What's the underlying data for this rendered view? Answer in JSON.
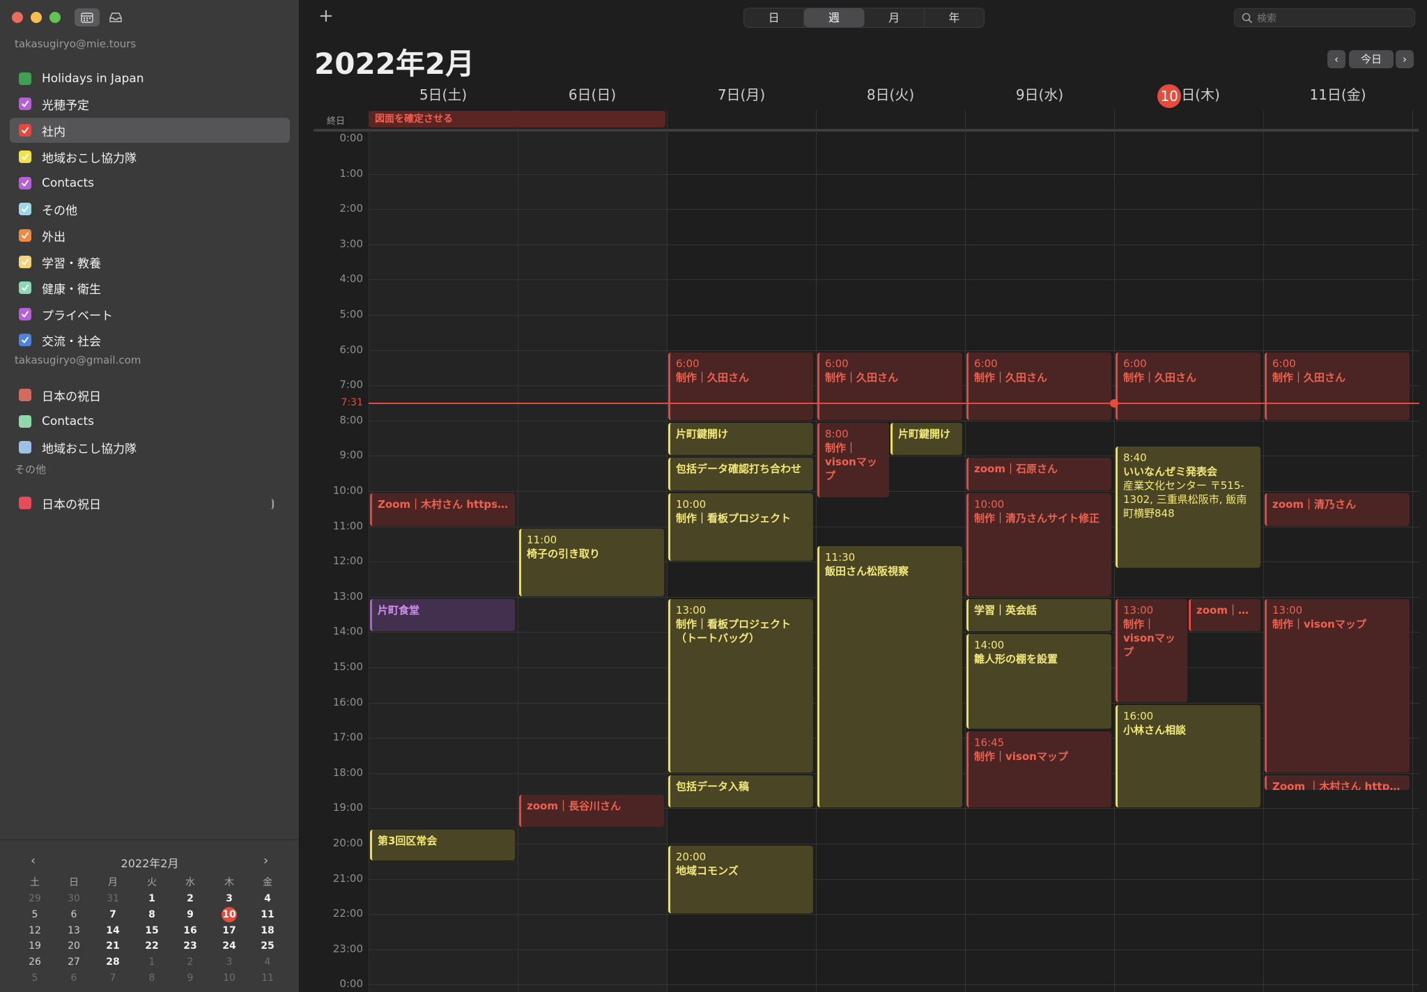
{
  "sidebar": {
    "accounts": [
      {
        "email": "takasugiryo@mie.tours",
        "calendars": [
          {
            "name": "Holidays in Japan",
            "color": "#3fa14f",
            "checked": false
          },
          {
            "name": "光穂予定",
            "color": "#b65fd6",
            "checked": true
          },
          {
            "name": "社内",
            "color": "#e8473c",
            "checked": true,
            "selected": true
          },
          {
            "name": "地域おこし協力隊",
            "color": "#f2e24a",
            "checked": true
          },
          {
            "name": "Contacts",
            "color": "#b65fd6",
            "checked": true
          },
          {
            "name": "その他",
            "color": "#9fd7e8",
            "checked": true
          },
          {
            "name": "外出",
            "color": "#f08a3e",
            "checked": true
          },
          {
            "name": "学習・教養",
            "color": "#f3d27a",
            "checked": true
          },
          {
            "name": "健康・衛生",
            "color": "#8bd8b2",
            "checked": true
          },
          {
            "name": "プライベート",
            "color": "#b65fd6",
            "checked": true
          },
          {
            "name": "交流・社会",
            "color": "#4c82e0",
            "checked": true
          }
        ]
      },
      {
        "email": "takasugiryo@gmail.com",
        "calendars": [
          {
            "name": "日本の祝日",
            "color": "#d46a5e",
            "checked": false
          },
          {
            "name": "Contacts",
            "color": "#8fd9a8",
            "checked": false
          },
          {
            "name": "地域おこし協力隊",
            "color": "#9fc0e6",
            "checked": false
          }
        ]
      },
      {
        "email": "その他",
        "calendars": [
          {
            "name": "日本の祝日",
            "color": "#e84b5a",
            "checked": false,
            "broadcast": true
          }
        ]
      }
    ]
  },
  "mini_calendar": {
    "title": "2022年2月",
    "prev": "‹",
    "next": "›",
    "weekdays": [
      "土",
      "日",
      "月",
      "火",
      "水",
      "木",
      "金"
    ],
    "weeks": [
      [
        {
          "d": "29",
          "dim": true
        },
        {
          "d": "30",
          "dim": true
        },
        {
          "d": "31",
          "dim": true
        },
        {
          "d": "1",
          "b": true
        },
        {
          "d": "2",
          "b": true
        },
        {
          "d": "3",
          "b": true
        },
        {
          "d": "4",
          "b": true
        }
      ],
      [
        {
          "d": "5"
        },
        {
          "d": "6"
        },
        {
          "d": "7",
          "b": true
        },
        {
          "d": "8",
          "b": true
        },
        {
          "d": "9",
          "b": true
        },
        {
          "d": "10",
          "today": true
        },
        {
          "d": "11",
          "b": true
        }
      ],
      [
        {
          "d": "12"
        },
        {
          "d": "13"
        },
        {
          "d": "14",
          "b": true
        },
        {
          "d": "15",
          "b": true
        },
        {
          "d": "16",
          "b": true
        },
        {
          "d": "17",
          "b": true
        },
        {
          "d": "18",
          "b": true
        }
      ],
      [
        {
          "d": "19"
        },
        {
          "d": "20"
        },
        {
          "d": "21",
          "b": true
        },
        {
          "d": "22",
          "b": true
        },
        {
          "d": "23",
          "b": true
        },
        {
          "d": "24",
          "b": true
        },
        {
          "d": "25",
          "b": true
        }
      ],
      [
        {
          "d": "26"
        },
        {
          "d": "27"
        },
        {
          "d": "28",
          "b": true
        },
        {
          "d": "1",
          "dim": true
        },
        {
          "d": "2",
          "dim": true
        },
        {
          "d": "3",
          "dim": true
        },
        {
          "d": "4",
          "dim": true
        }
      ],
      [
        {
          "d": "5",
          "dim": true
        },
        {
          "d": "6",
          "dim": true
        },
        {
          "d": "7",
          "dim": true
        },
        {
          "d": "8",
          "dim": true
        },
        {
          "d": "9",
          "dim": true
        },
        {
          "d": "10",
          "dim": true
        },
        {
          "d": "11",
          "dim": true
        }
      ]
    ]
  },
  "toolbar": {
    "add": "+",
    "views": [
      "日",
      "週",
      "月",
      "年"
    ],
    "active_view": "週",
    "search_placeholder": "検索"
  },
  "header": {
    "title": "2022年2月",
    "prev": "‹",
    "today": "今日",
    "next": "›"
  },
  "days": [
    {
      "label": "5日(土)",
      "weekend": true
    },
    {
      "label": "6日(日)",
      "weekend": true
    },
    {
      "label": "7日(月)"
    },
    {
      "label": "8日(火)"
    },
    {
      "label": "9日(水)"
    },
    {
      "num": "10",
      "rest": "日(木)",
      "today": true
    },
    {
      "label": "11日(金)"
    }
  ],
  "allday_label": "終日",
  "allday_events": [
    {
      "title": "図面を確定させる",
      "day": 0,
      "span": 2,
      "color": "red"
    }
  ],
  "hours": [
    "0:00",
    "1:00",
    "2:00",
    "3:00",
    "4:00",
    "5:00",
    "6:00",
    "7:00",
    "8:00",
    "9:00",
    "10:00",
    "11:00",
    "12:00",
    "13:00",
    "14:00",
    "15:00",
    "16:00",
    "17:00",
    "18:00",
    "19:00",
    "20:00",
    "21:00",
    "22:00",
    "23:00",
    "0:00"
  ],
  "now": {
    "label": "7:31",
    "hour": 7.5167,
    "day": 5
  },
  "events": [
    {
      "day": 0,
      "start": 10,
      "end": 11,
      "color": "red",
      "single": "Zoom｜木村さん  https://..."
    },
    {
      "day": 0,
      "start": 13,
      "end": 14,
      "color": "pur",
      "title": "片町食堂"
    },
    {
      "day": 0,
      "start": 19.55,
      "end": 20.5,
      "color": "yel",
      "title": "第3回区常会"
    },
    {
      "day": 1,
      "start": 11,
      "end": 13,
      "color": "yel",
      "time": "11:00",
      "title": "椅子の引き取り"
    },
    {
      "day": 1,
      "start": 18.55,
      "end": 19.55,
      "color": "red",
      "single": "zoom｜長谷川さん"
    },
    {
      "day": 2,
      "start": 6,
      "end": 8,
      "color": "red",
      "time": "6:00",
      "title": "制作｜久田さん"
    },
    {
      "day": 2,
      "start": 8,
      "end": 9,
      "color": "yel",
      "title": "片町鍵開け"
    },
    {
      "day": 2,
      "start": 9,
      "end": 10,
      "color": "yel",
      "title": "包括データ確認打ち合わせ"
    },
    {
      "day": 2,
      "start": 10,
      "end": 12,
      "color": "yel",
      "time": "10:00",
      "title": "制作｜看板プロジェクト"
    },
    {
      "day": 2,
      "start": 13,
      "end": 18,
      "color": "yel",
      "time": "13:00",
      "title": "制作｜看板プロジェクト（トートバッグ）"
    },
    {
      "day": 2,
      "start": 18,
      "end": 19,
      "color": "yel",
      "title": "包括データ入稿"
    },
    {
      "day": 2,
      "start": 20,
      "end": 22,
      "color": "yel",
      "time": "20:00",
      "title": "地域コモンズ"
    },
    {
      "day": 3,
      "start": 6,
      "end": 8,
      "color": "red",
      "time": "6:00",
      "title": "制作｜久田さん"
    },
    {
      "day": 3,
      "start": 8,
      "end": 10.2,
      "color": "red",
      "time": "8:00",
      "title": "制作｜visonマップ",
      "col": 0,
      "cols": 2
    },
    {
      "day": 3,
      "start": 8,
      "end": 9,
      "color": "yel",
      "title": "片町鍵開け",
      "col": 1,
      "cols": 2
    },
    {
      "day": 3,
      "start": 11.5,
      "end": 19,
      "color": "yel",
      "time": "11:30",
      "title": "飯田さん松阪視察"
    },
    {
      "day": 4,
      "start": 6,
      "end": 8,
      "color": "red",
      "time": "6:00",
      "title": "制作｜久田さん"
    },
    {
      "day": 4,
      "start": 9,
      "end": 10,
      "color": "red",
      "single": "zoom｜石原さん"
    },
    {
      "day": 4,
      "start": 10,
      "end": 13,
      "color": "red",
      "time": "10:00",
      "title": "制作｜清乃さんサイト修正"
    },
    {
      "day": 4,
      "start": 13,
      "end": 14,
      "color": "yel",
      "title": "学習｜英会話"
    },
    {
      "day": 4,
      "start": 14,
      "end": 16.75,
      "color": "yel",
      "time": "14:00",
      "title": "雛人形の棚を設置"
    },
    {
      "day": 4,
      "start": 16.75,
      "end": 19,
      "color": "red",
      "time": "16:45",
      "title": "制作｜visonマップ"
    },
    {
      "day": 5,
      "start": 6,
      "end": 8,
      "color": "red",
      "time": "6:00",
      "title": "制作｜久田さん"
    },
    {
      "day": 5,
      "start": 8.67,
      "end": 12.2,
      "color": "yel",
      "time": "8:40",
      "title": "いいなんぜミ発表会",
      "desc": "産業文化センター 〒515-1302, 三重県松阪市, 飯南町横野848"
    },
    {
      "day": 5,
      "start": 13,
      "end": 16,
      "color": "red",
      "time": "13:00",
      "title": "制作｜visonマップ",
      "col": 0,
      "cols": 2
    },
    {
      "day": 5,
      "start": 13,
      "end": 14,
      "color": "red",
      "single": "zoom｜vi...",
      "col": 1,
      "cols": 2
    },
    {
      "day": 5,
      "start": 16,
      "end": 19,
      "color": "yel",
      "time": "16:00",
      "title": "小林さん相談"
    },
    {
      "day": 6,
      "start": 6,
      "end": 8,
      "color": "red",
      "time": "6:00",
      "title": "制作｜久田さん"
    },
    {
      "day": 6,
      "start": 10,
      "end": 11,
      "color": "red",
      "single": "zoom｜清乃さん"
    },
    {
      "day": 6,
      "start": 13,
      "end": 18,
      "color": "red",
      "time": "13:00",
      "title": "制作｜visonマップ"
    },
    {
      "day": 6,
      "start": 18,
      "end": 18.5,
      "color": "red",
      "single": "Zoom ｜木村さん  https:/..."
    }
  ]
}
